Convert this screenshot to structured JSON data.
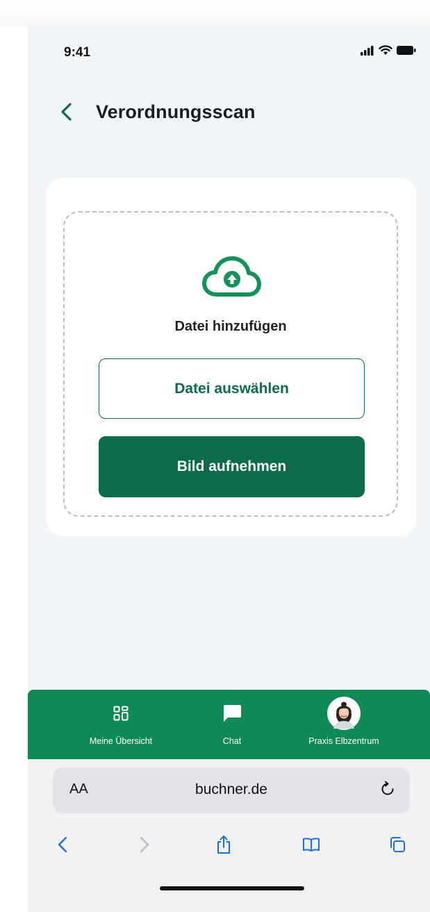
{
  "status_bar": {
    "time": "9:41"
  },
  "header": {
    "title": "Verordnungsscan"
  },
  "upload": {
    "label": "Datei hinzufügen",
    "select_button": "Datei auswählen",
    "photo_button": "Bild aufnehmen"
  },
  "tabbar": {
    "items": [
      {
        "label": "Meine Übersicht",
        "icon": "dashboard-grid-icon"
      },
      {
        "label": "Chat",
        "icon": "chat-bubble-icon"
      },
      {
        "label": "Praxis Elbzentrum",
        "icon": "avatar"
      }
    ]
  },
  "browser": {
    "text_size_label": "AA",
    "url": "buchner.de"
  },
  "colors": {
    "accent_dark": "#0b6b4a",
    "accent_green": "#0f8a55",
    "background": "#f3f6f9"
  }
}
